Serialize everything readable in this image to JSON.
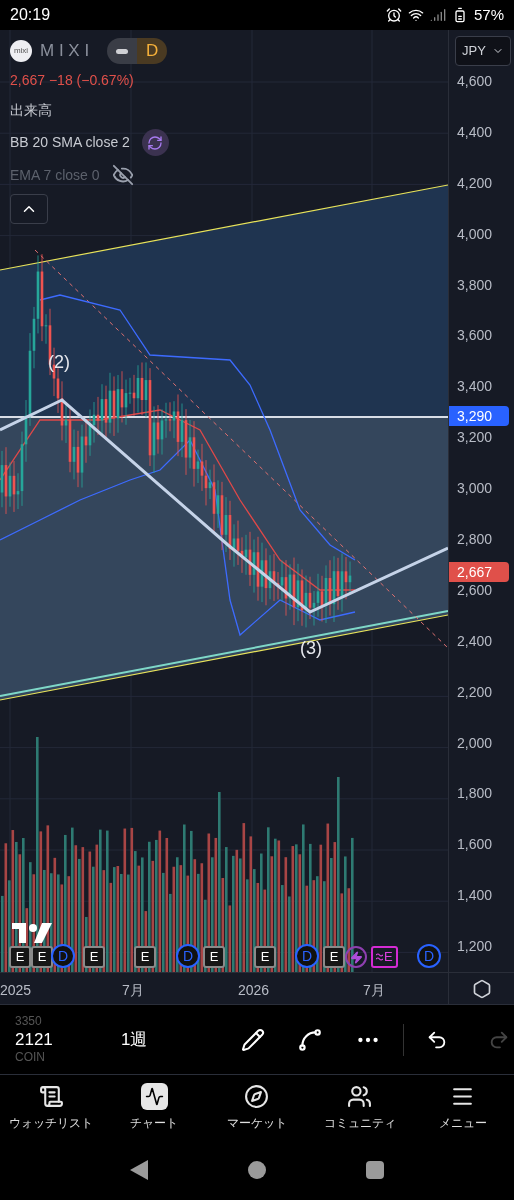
{
  "status_bar": {
    "time": "20:19",
    "battery": "57%"
  },
  "symbol": {
    "logo_text": "mixi",
    "name": "M I X I",
    "interval": "D",
    "price_line": "2,667 −18 (−0.67%)"
  },
  "indicators": [
    {
      "label": "出来高",
      "kind": "plain",
      "hidden": false
    },
    {
      "label": "BB 20 SMA close 2",
      "kind": "sync",
      "hidden": false
    },
    {
      "label": "EMA 7 close 0",
      "kind": "plain",
      "hidden": true
    }
  ],
  "currency": "JPY",
  "axis_labels": [
    "4,600",
    "4,400",
    "4,200",
    "4,000",
    "3,800",
    "3,600",
    "3,400",
    "3,200",
    "3,000",
    "2,800",
    "2,600",
    "2,400",
    "2,200",
    "2,000",
    "1,800",
    "1,600",
    "1,400",
    "1,200"
  ],
  "price_badges": [
    {
      "label": "3,290",
      "color": "#2962ff"
    },
    {
      "label": "2,667",
      "color": "#e0504a"
    }
  ],
  "wave_labels": [
    "(2)",
    "(3)"
  ],
  "events": [
    {
      "kind": "earnings",
      "label": "E"
    },
    {
      "kind": "earnings",
      "label": "E"
    },
    {
      "kind": "dividend",
      "label": "D"
    },
    {
      "kind": "earnings",
      "label": "E"
    },
    {
      "kind": "earnings",
      "label": "E"
    },
    {
      "kind": "dividend",
      "label": "D"
    },
    {
      "kind": "earnings",
      "label": "E"
    },
    {
      "kind": "earnings",
      "label": "E"
    },
    {
      "kind": "dividend",
      "label": "D"
    },
    {
      "kind": "earnings",
      "label": "E"
    },
    {
      "kind": "split"
    },
    {
      "kind": "upcoming",
      "label": "E"
    },
    {
      "kind": "dividend",
      "label": "D"
    }
  ],
  "time_axis": [
    "2025",
    "7月",
    "2026",
    "7月"
  ],
  "toolbar": {
    "picker": [
      "3350",
      "2121",
      "COIN"
    ],
    "interval": "1週"
  },
  "nav": [
    {
      "label": "ウォッチリスト",
      "selected": false
    },
    {
      "label": "チャート",
      "selected": true
    },
    {
      "label": "マーケット",
      "selected": false
    },
    {
      "label": "コミュニティ",
      "selected": false
    },
    {
      "label": "メニュー",
      "selected": false
    }
  ]
}
